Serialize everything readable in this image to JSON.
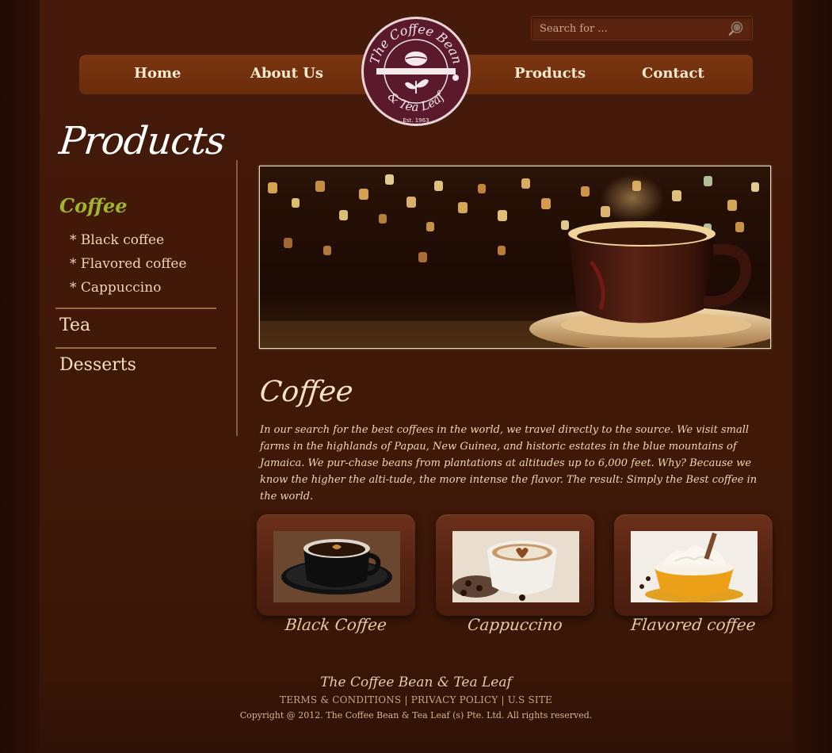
{
  "search": {
    "placeholder": "Search for ..."
  },
  "nav": {
    "home": "Home",
    "about": "About Us",
    "products": "Products",
    "contact": "Contact"
  },
  "logo": {
    "alt": "The Coffee Bean & Tea Leaf — Est 1963"
  },
  "sidebar": {
    "title": "Products",
    "active_category": "Coffee",
    "sub_items": [
      "* Black coffee",
      "* Flavored coffee",
      "* Cappuccino"
    ],
    "categories": [
      "Tea",
      "Desserts"
    ]
  },
  "content": {
    "title": "Coffee",
    "text": "In our search for the best coffees in the world, we travel directly to the source. We visit small farms in the highlands of Papau, New Guinea, and historic estates in the blue mountains of Jamaica. We pur-chase beans from plantations at altitudes up to 6,000 feet. Why? Because we know the higher the alti-tude, the more intense the flavor. The result: Simply the Best coffee in the world."
  },
  "products": [
    {
      "label": "Black Coffee"
    },
    {
      "label": "Cappuccino"
    },
    {
      "label": "Flavored coffee"
    }
  ],
  "footer": {
    "brand": "The Coffee Bean & Tea Leaf",
    "links": [
      "TERMS & CONDITIONS",
      "PRIVACY POLICY",
      "U.S SITE"
    ],
    "copyright": "Copyright @ 2012. The Coffee Bean & Tea Leaf (s) Pte. Ltd. All rights reserved."
  },
  "colors": {
    "background": "#451a0a",
    "nav": "#7a3510",
    "accent_green": "#9fb52a",
    "text_cream": "#f0d7b0"
  }
}
